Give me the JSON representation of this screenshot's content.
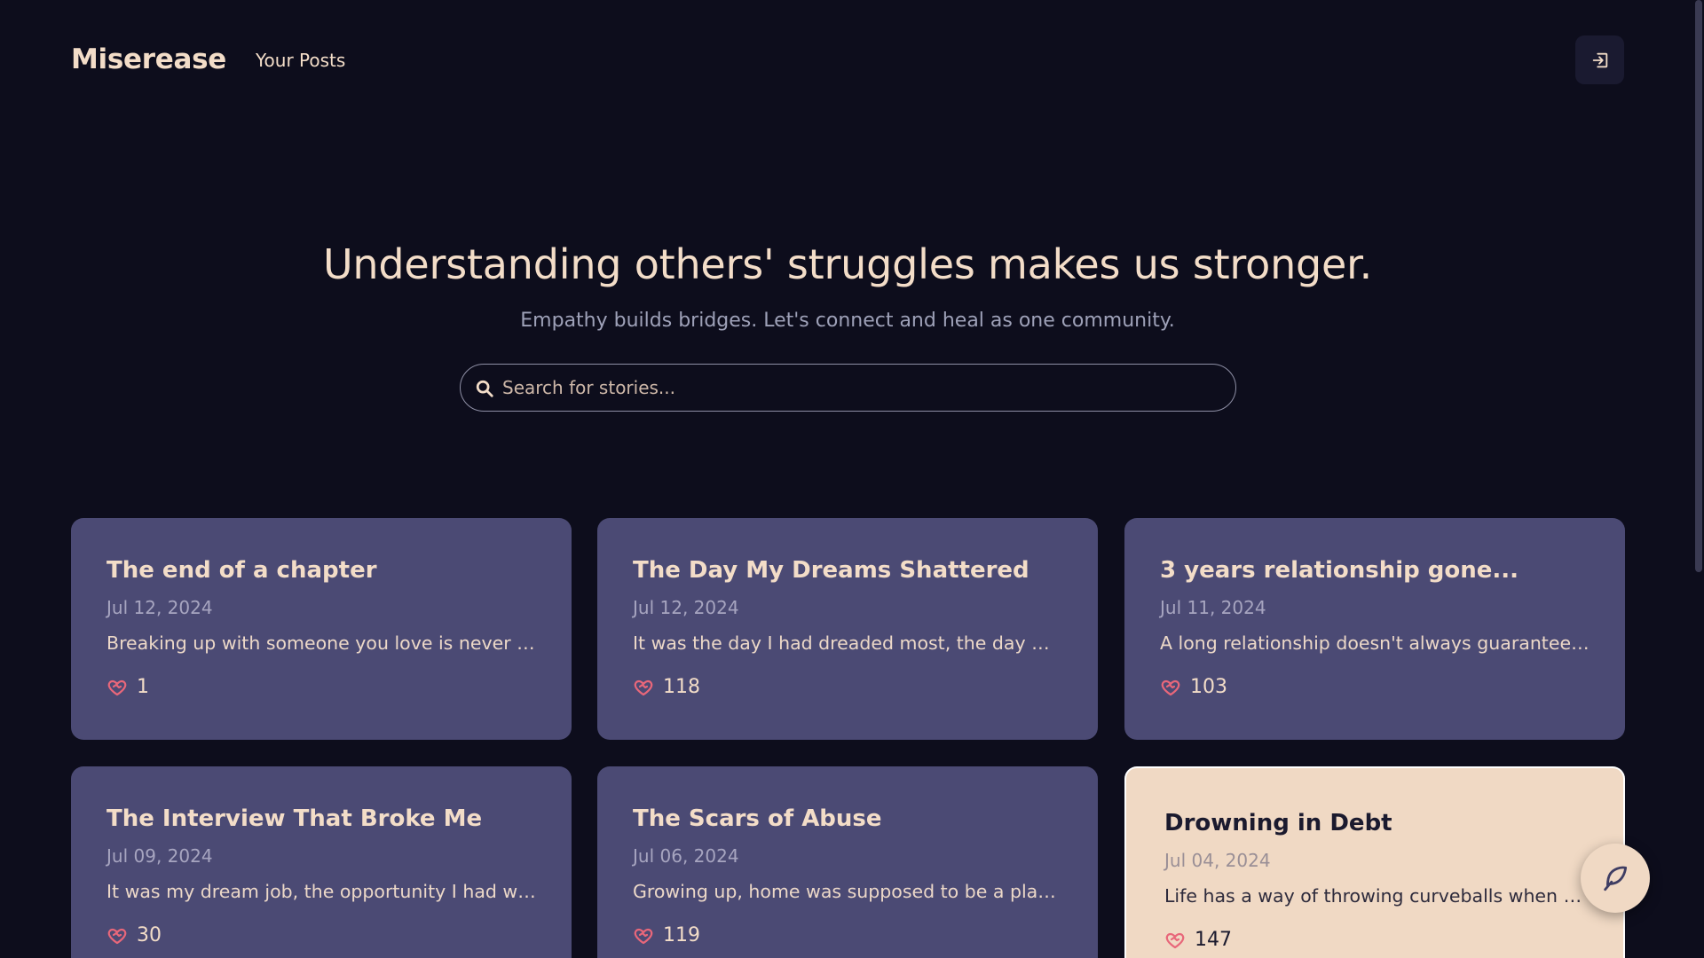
{
  "navbar": {
    "brand": "Miserease",
    "links": [
      {
        "label": "Your Posts"
      }
    ],
    "logout_icon": "logout-icon"
  },
  "hero": {
    "title": "Understanding others' struggles makes us stronger.",
    "subtitle": "Empathy builds bridges. Let's connect and heal as one community."
  },
  "search": {
    "placeholder": "Search for stories...",
    "value": "",
    "icon": "search-icon"
  },
  "posts": [
    {
      "title": "The end of a chapter",
      "date": "Jul 12, 2024",
      "excerpt": "Breaking up with someone you love is never ea...",
      "likes": "1"
    },
    {
      "title": "The Day My Dreams Shattered",
      "date": "Jul 12, 2024",
      "excerpt": "It was the day I had dreaded most, the day my ...",
      "likes": "118"
    },
    {
      "title": "3 years relationship gone...",
      "date": "Jul 11, 2024",
      "excerpt": "A long relationship doesn't always guarantee a...",
      "likes": "103"
    },
    {
      "title": "The Interview That Broke Me",
      "date": "Jul 09, 2024",
      "excerpt": "It was my dream job, the opportunity I had wor...",
      "likes": "30"
    },
    {
      "title": "The Scars of Abuse",
      "date": "Jul 06, 2024",
      "excerpt": "Growing up, home was supposed to be a place...",
      "likes": "119"
    },
    {
      "title": "Drowning in Debt",
      "date": "Jul 04, 2024",
      "excerpt": "Life has a way of throwing curveballs when yo...",
      "likes": "147",
      "hovered": true
    }
  ],
  "fab": {
    "icon": "feather-icon"
  },
  "colors": {
    "background": "#0d0d1c",
    "card": "#4b4a74",
    "card_hover": "#f0d9c4",
    "accent": "#f3ddc8",
    "like": "#e8677a"
  }
}
